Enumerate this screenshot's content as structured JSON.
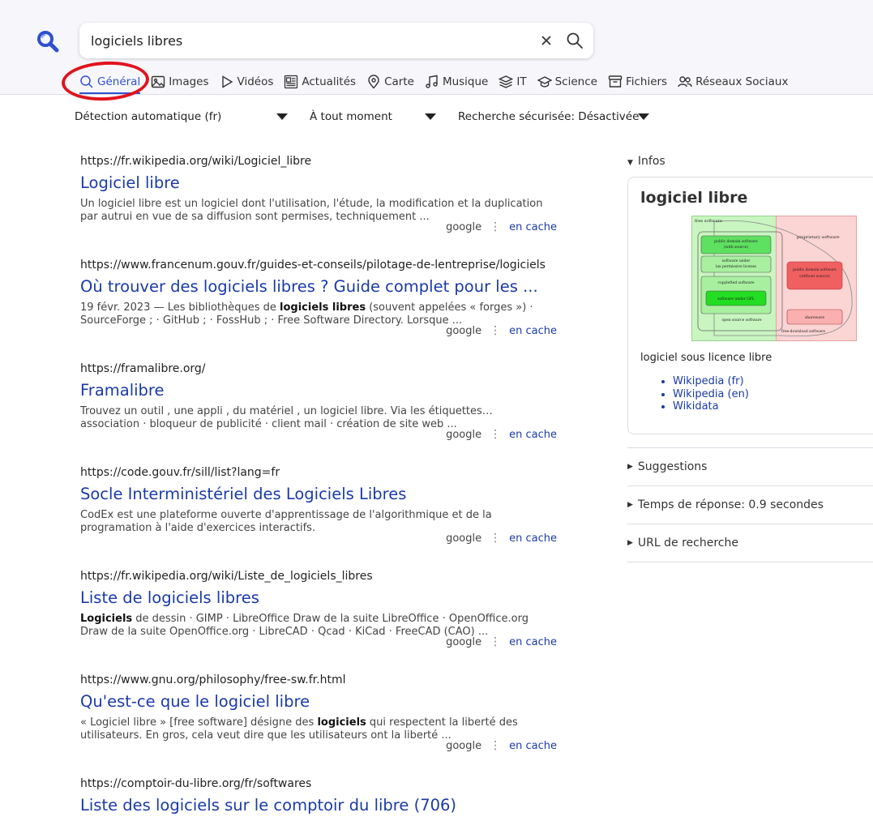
{
  "search": {
    "query": "logiciels libres"
  },
  "tabs": [
    {
      "label": "Général",
      "icon": "search-icon"
    },
    {
      "label": "Images",
      "icon": "image-icon"
    },
    {
      "label": "Vidéos",
      "icon": "play-icon"
    },
    {
      "label": "Actualités",
      "icon": "newspaper-icon"
    },
    {
      "label": "Carte",
      "icon": "map-pin-icon"
    },
    {
      "label": "Musique",
      "icon": "music-note-icon"
    },
    {
      "label": "IT",
      "icon": "layers-icon"
    },
    {
      "label": "Science",
      "icon": "graduation-cap-icon"
    },
    {
      "label": "Fichiers",
      "icon": "archive-icon"
    },
    {
      "label": "Réseaux Sociaux",
      "icon": "people-icon"
    }
  ],
  "filters": {
    "language": "Détection automatique (fr)",
    "time": "À tout moment",
    "safe": "Recherche sécurisée: Désactivée"
  },
  "results": [
    {
      "url": "https://fr.wikipedia.org/wiki/Logiciel_libre",
      "title": "Logiciel libre",
      "snippet": "Un logiciel libre est un logiciel dont l'utilisation, l'étude, la modification et la duplication par autrui en vue de sa diffusion sont permises, techniquement ...",
      "engine": "google",
      "cache": "en cache"
    },
    {
      "url": "https://www.francenum.gouv.fr/guides-et-conseils/pilotage-de-lentreprise/logiciels",
      "title": "Où trouver des logiciels libres ? Guide complet pour les ...",
      "snippet_html": "19 févr. 2023 — Les bibliothèques de <b>logiciels libres</b> (souvent appelées « forges ») · SourceForge ; · GitHub ; · FossHub ; · Free Software Directory. Lorsque ...",
      "engine": "google",
      "cache": "en cache"
    },
    {
      "url": "https://framalibre.org/",
      "title": "Framalibre",
      "snippet": "Trouvez un outil , une appli , du matériel , un logiciel libre. Via les étiquettes… association · bloqueur de publicité · client mail · création de site web ...",
      "engine": "google",
      "cache": "en cache"
    },
    {
      "url": "https://code.gouv.fr/sill/list?lang=fr",
      "title": "Socle Interministériel des Logiciels Libres",
      "snippet": "CodEx est une plateforme ouverte d'apprentissage de l'algorithmique et de la programation à l'aide d'exercices interactifs.",
      "engine": "google",
      "cache": "en cache"
    },
    {
      "url": "https://fr.wikipedia.org/wiki/Liste_de_logiciels_libres",
      "title": "Liste de logiciels libres",
      "snippet_html": "<b>Logiciels</b> de dessin · GIMP · LibreOffice Draw de la suite LibreOffice · OpenOffice.org Draw de la suite OpenOffice.org · LibreCAD · Qcad · KiCad · FreeCAD (CAO) ...",
      "engine": "google",
      "cache": "en cache"
    },
    {
      "url": "https://www.gnu.org/philosophy/free-sw.fr.html",
      "title": "Qu'est-ce que le logiciel libre",
      "snippet_html": "« Logiciel libre » [free software] désigne des <b>logiciels</b> qui respectent la liberté des utilisateurs. En gros, cela veut dire que les utilisateurs ont la liberté ...",
      "engine": "google",
      "cache": "en cache"
    },
    {
      "url": "https://comptoir-du-libre.org/fr/softwares",
      "title": "Liste des logiciels sur le comptoir du libre (706)"
    }
  ],
  "sidebar": {
    "infos_label": "Infos",
    "infobox": {
      "title": "logiciel libre",
      "description": "logiciel sous licence libre",
      "links": [
        "Wikipedia (fr)",
        "Wikipedia (en)",
        "Wikidata"
      ],
      "diagram": {
        "free_software": "free software",
        "proprietary": "proprietary software",
        "pd_source": [
          "public domain software",
          "(with source)"
        ],
        "permissive": [
          "software under",
          "lax permissive license"
        ],
        "copylefted": "copylefted software",
        "gpl": "software under GPL",
        "open_source": "open source software",
        "pd_nosource": [
          "public domain software",
          "(without source)"
        ],
        "shareware": "shareware",
        "free_download": "free-download software"
      }
    },
    "sections": [
      "Suggestions",
      "Temps de réponse: 0.9 secondes",
      "URL de recherche"
    ]
  },
  "colors": {
    "accent": "#3050d0",
    "link": "#1a3aa8",
    "highlight": "#e0141e"
  }
}
